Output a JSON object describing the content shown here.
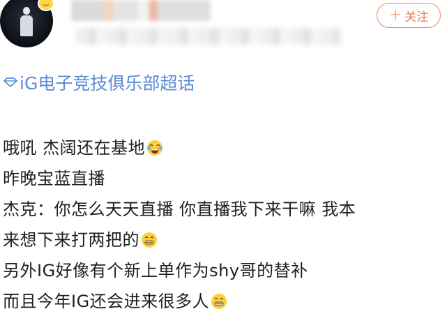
{
  "header": {
    "follow_label": "关注",
    "follow_icon": "plus-icon"
  },
  "topic": {
    "icon": "topic-diamond-icon",
    "label": "iG电子竞技俱乐部超话"
  },
  "post": {
    "lines": [
      {
        "text": "哦吼 杰阔还在基地",
        "emoji": "laugh-cry-emoji"
      },
      {
        "text": "昨晚宝蓝直播",
        "emoji": null
      },
      {
        "text": "杰克：你怎么天天直播 你直播我下来干嘛 我本",
        "emoji": null
      },
      {
        "text": "来想下来打两把的",
        "emoji": "grin-emoji"
      },
      {
        "text": "另外IG好像有个新上单作为shy哥的替补",
        "emoji": null
      },
      {
        "text": "而且今年IG还会进来很多人",
        "emoji": "grin-emoji"
      }
    ]
  },
  "colors": {
    "accent_orange": "#ee7a47",
    "link_blue": "#5b8bd6"
  }
}
